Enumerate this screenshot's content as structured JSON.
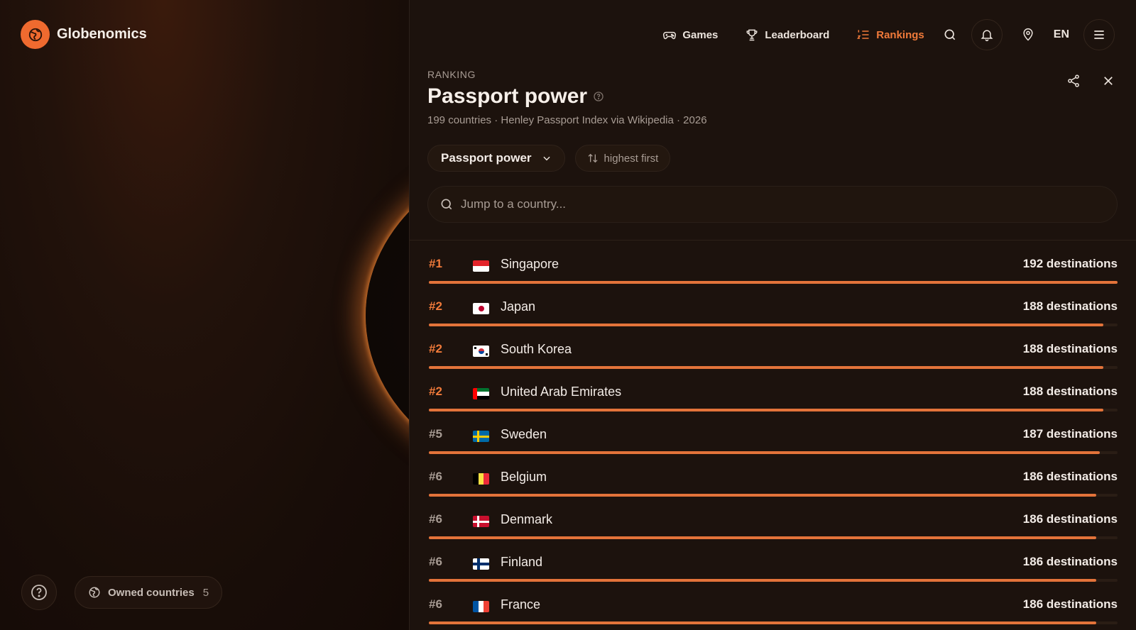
{
  "brand": {
    "name": "Globenomics",
    "accent": "#ef6a2f"
  },
  "nav": {
    "items": [
      {
        "label": "Games",
        "icon": "gamepad-icon",
        "active": false
      },
      {
        "label": "Leaderboard",
        "icon": "trophy-icon",
        "active": false
      },
      {
        "label": "Rankings",
        "icon": "list-numbered-icon",
        "active": true
      }
    ],
    "language": "EN"
  },
  "ranking": {
    "eyebrow": "RANKING",
    "title": "Passport power",
    "subtitle": "199 countries · Henley Passport Index via Wikipedia · 2026",
    "metric_select": "Passport power",
    "sort_label": "highest first",
    "search_placeholder": "Jump to a country...",
    "max_value": 192,
    "rows": [
      {
        "rank": "#1",
        "top": true,
        "flag": "SG",
        "country": "Singapore",
        "value": 192,
        "value_label": "192 destinations"
      },
      {
        "rank": "#2",
        "top": true,
        "flag": "JP",
        "country": "Japan",
        "value": 188,
        "value_label": "188 destinations"
      },
      {
        "rank": "#2",
        "top": true,
        "flag": "KR",
        "country": "South Korea",
        "value": 188,
        "value_label": "188 destinations"
      },
      {
        "rank": "#2",
        "top": true,
        "flag": "AE",
        "country": "United Arab Emirates",
        "value": 188,
        "value_label": "188 destinations"
      },
      {
        "rank": "#5",
        "top": false,
        "flag": "SE",
        "country": "Sweden",
        "value": 187,
        "value_label": "187 destinations"
      },
      {
        "rank": "#6",
        "top": false,
        "flag": "BE",
        "country": "Belgium",
        "value": 186,
        "value_label": "186 destinations"
      },
      {
        "rank": "#6",
        "top": false,
        "flag": "DK",
        "country": "Denmark",
        "value": 186,
        "value_label": "186 destinations"
      },
      {
        "rank": "#6",
        "top": false,
        "flag": "FI",
        "country": "Finland",
        "value": 186,
        "value_label": "186 destinations"
      },
      {
        "rank": "#6",
        "top": false,
        "flag": "FR",
        "country": "France",
        "value": 186,
        "value_label": "186 destinations"
      }
    ]
  },
  "footer": {
    "owned_label": "Owned countries",
    "owned_count": "5"
  },
  "colors": {
    "accent": "#f07a3a",
    "bar": "#e3733a"
  }
}
